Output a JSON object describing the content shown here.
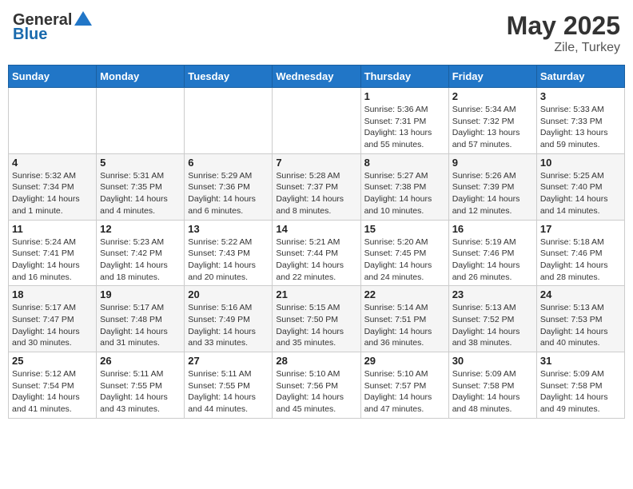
{
  "header": {
    "logo_line1": "General",
    "logo_line2": "Blue",
    "month": "May 2025",
    "location": "Zile, Turkey"
  },
  "days_of_week": [
    "Sunday",
    "Monday",
    "Tuesday",
    "Wednesday",
    "Thursday",
    "Friday",
    "Saturday"
  ],
  "weeks": [
    [
      {
        "day": "",
        "info": ""
      },
      {
        "day": "",
        "info": ""
      },
      {
        "day": "",
        "info": ""
      },
      {
        "day": "",
        "info": ""
      },
      {
        "day": "1",
        "info": "Sunrise: 5:36 AM\nSunset: 7:31 PM\nDaylight: 13 hours and 55 minutes."
      },
      {
        "day": "2",
        "info": "Sunrise: 5:34 AM\nSunset: 7:32 PM\nDaylight: 13 hours and 57 minutes."
      },
      {
        "day": "3",
        "info": "Sunrise: 5:33 AM\nSunset: 7:33 PM\nDaylight: 13 hours and 59 minutes."
      }
    ],
    [
      {
        "day": "4",
        "info": "Sunrise: 5:32 AM\nSunset: 7:34 PM\nDaylight: 14 hours and 1 minute."
      },
      {
        "day": "5",
        "info": "Sunrise: 5:31 AM\nSunset: 7:35 PM\nDaylight: 14 hours and 4 minutes."
      },
      {
        "day": "6",
        "info": "Sunrise: 5:29 AM\nSunset: 7:36 PM\nDaylight: 14 hours and 6 minutes."
      },
      {
        "day": "7",
        "info": "Sunrise: 5:28 AM\nSunset: 7:37 PM\nDaylight: 14 hours and 8 minutes."
      },
      {
        "day": "8",
        "info": "Sunrise: 5:27 AM\nSunset: 7:38 PM\nDaylight: 14 hours and 10 minutes."
      },
      {
        "day": "9",
        "info": "Sunrise: 5:26 AM\nSunset: 7:39 PM\nDaylight: 14 hours and 12 minutes."
      },
      {
        "day": "10",
        "info": "Sunrise: 5:25 AM\nSunset: 7:40 PM\nDaylight: 14 hours and 14 minutes."
      }
    ],
    [
      {
        "day": "11",
        "info": "Sunrise: 5:24 AM\nSunset: 7:41 PM\nDaylight: 14 hours and 16 minutes."
      },
      {
        "day": "12",
        "info": "Sunrise: 5:23 AM\nSunset: 7:42 PM\nDaylight: 14 hours and 18 minutes."
      },
      {
        "day": "13",
        "info": "Sunrise: 5:22 AM\nSunset: 7:43 PM\nDaylight: 14 hours and 20 minutes."
      },
      {
        "day": "14",
        "info": "Sunrise: 5:21 AM\nSunset: 7:44 PM\nDaylight: 14 hours and 22 minutes."
      },
      {
        "day": "15",
        "info": "Sunrise: 5:20 AM\nSunset: 7:45 PM\nDaylight: 14 hours and 24 minutes."
      },
      {
        "day": "16",
        "info": "Sunrise: 5:19 AM\nSunset: 7:46 PM\nDaylight: 14 hours and 26 minutes."
      },
      {
        "day": "17",
        "info": "Sunrise: 5:18 AM\nSunset: 7:46 PM\nDaylight: 14 hours and 28 minutes."
      }
    ],
    [
      {
        "day": "18",
        "info": "Sunrise: 5:17 AM\nSunset: 7:47 PM\nDaylight: 14 hours and 30 minutes."
      },
      {
        "day": "19",
        "info": "Sunrise: 5:17 AM\nSunset: 7:48 PM\nDaylight: 14 hours and 31 minutes."
      },
      {
        "day": "20",
        "info": "Sunrise: 5:16 AM\nSunset: 7:49 PM\nDaylight: 14 hours and 33 minutes."
      },
      {
        "day": "21",
        "info": "Sunrise: 5:15 AM\nSunset: 7:50 PM\nDaylight: 14 hours and 35 minutes."
      },
      {
        "day": "22",
        "info": "Sunrise: 5:14 AM\nSunset: 7:51 PM\nDaylight: 14 hours and 36 minutes."
      },
      {
        "day": "23",
        "info": "Sunrise: 5:13 AM\nSunset: 7:52 PM\nDaylight: 14 hours and 38 minutes."
      },
      {
        "day": "24",
        "info": "Sunrise: 5:13 AM\nSunset: 7:53 PM\nDaylight: 14 hours and 40 minutes."
      }
    ],
    [
      {
        "day": "25",
        "info": "Sunrise: 5:12 AM\nSunset: 7:54 PM\nDaylight: 14 hours and 41 minutes."
      },
      {
        "day": "26",
        "info": "Sunrise: 5:11 AM\nSunset: 7:55 PM\nDaylight: 14 hours and 43 minutes."
      },
      {
        "day": "27",
        "info": "Sunrise: 5:11 AM\nSunset: 7:55 PM\nDaylight: 14 hours and 44 minutes."
      },
      {
        "day": "28",
        "info": "Sunrise: 5:10 AM\nSunset: 7:56 PM\nDaylight: 14 hours and 45 minutes."
      },
      {
        "day": "29",
        "info": "Sunrise: 5:10 AM\nSunset: 7:57 PM\nDaylight: 14 hours and 47 minutes."
      },
      {
        "day": "30",
        "info": "Sunrise: 5:09 AM\nSunset: 7:58 PM\nDaylight: 14 hours and 48 minutes."
      },
      {
        "day": "31",
        "info": "Sunrise: 5:09 AM\nSunset: 7:58 PM\nDaylight: 14 hours and 49 minutes."
      }
    ]
  ]
}
